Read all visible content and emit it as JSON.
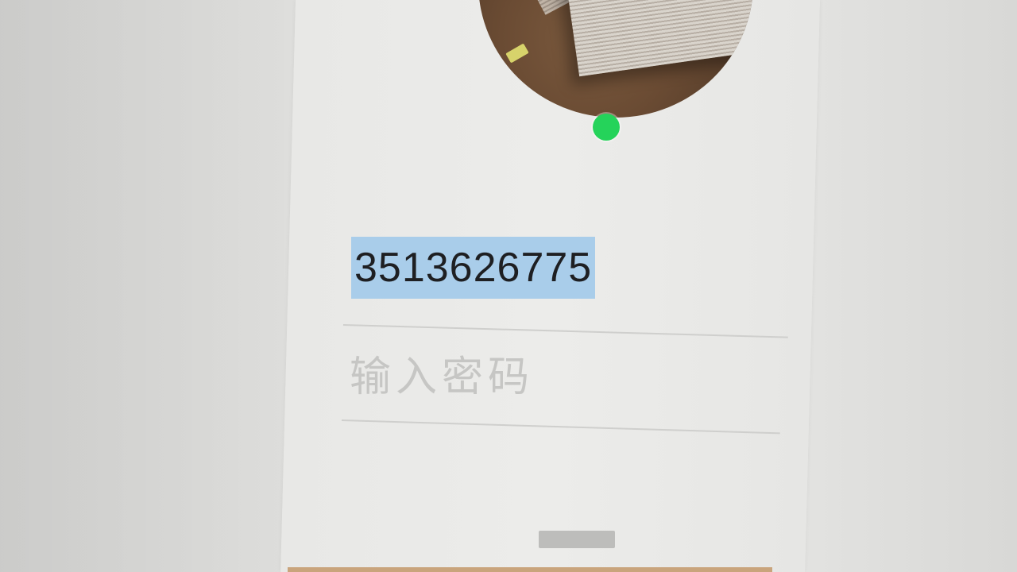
{
  "login": {
    "account": "3513626775",
    "password_placeholder": "输入密码"
  },
  "avatar": {
    "status": "online"
  },
  "colors": {
    "selection": "#a9cdea",
    "status_online": "#25d35a",
    "placeholder": "#c6c6c4"
  }
}
